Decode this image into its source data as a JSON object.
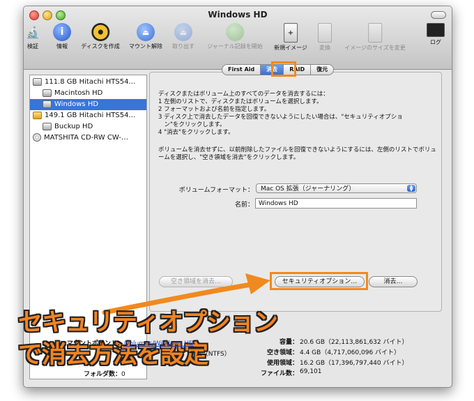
{
  "window": {
    "title": "Windows HD"
  },
  "toolbar": [
    {
      "id": "verify",
      "label": "検証",
      "icon": "microscope-icon",
      "enabled": true
    },
    {
      "id": "info",
      "label": "情報",
      "icon": "info-icon",
      "enabled": true
    },
    {
      "id": "burn",
      "label": "ディスクを作成",
      "icon": "burn-icon",
      "enabled": true
    },
    {
      "id": "unmount",
      "label": "マウント解除",
      "icon": "unmount-icon",
      "enabled": true
    },
    {
      "id": "eject",
      "label": "取り出す",
      "icon": "eject-icon",
      "enabled": false
    },
    {
      "id": "journal",
      "label": "ジャーナル記録を開始",
      "icon": "journal-icon",
      "enabled": false
    },
    {
      "id": "new-image",
      "label": "新規イメージ",
      "icon": "new-image-icon",
      "enabled": true
    },
    {
      "id": "convert",
      "label": "変換",
      "icon": "convert-icon",
      "enabled": false
    },
    {
      "id": "resize-image",
      "label": "イメージのサイズを変更",
      "icon": "resize-image-icon",
      "enabled": false
    },
    {
      "id": "log",
      "label": "ログ",
      "icon": "log-icon",
      "enabled": true
    }
  ],
  "sidebar": {
    "items": [
      {
        "label": "111.8 GB Hitachi HTS54…",
        "type": "disk",
        "indent": 0,
        "selected": false
      },
      {
        "label": "Macintosh HD",
        "type": "volume",
        "indent": 1,
        "selected": false
      },
      {
        "label": "Windows HD",
        "type": "volume",
        "indent": 1,
        "selected": true
      },
      {
        "label": "149.1 GB Hitachi HTS54…",
        "type": "external-disk",
        "indent": 0,
        "selected": false
      },
      {
        "label": "Buckup HD",
        "type": "volume",
        "indent": 1,
        "selected": false
      },
      {
        "label": "MATSHITA CD-RW CW-…",
        "type": "cd",
        "indent": 0,
        "selected": false
      }
    ]
  },
  "tabs": [
    {
      "label": "First Aid",
      "active": false
    },
    {
      "label": "消去",
      "active": true
    },
    {
      "label": "RAID",
      "active": false
    },
    {
      "label": "復元",
      "active": false
    }
  ],
  "erase": {
    "instructions": "ディスクまたはボリューム上のすべてのデータを消去するには：\n1 左側のリストで、ディスクまたはボリュームを選択します。\n2 フォーマットおよび名前を指定します。\n3 ディスク上で消去したデータを回復できないようにしたい場合は、\"セキュリティオプショ\n　ン\"をクリックします。\n4 \"消去\"をクリックします。",
    "note": "ボリュームを消去せずに、以前削除したファイルを回復できないようにするには、左側のリストでボリュームを選択し、\"空き領域を消去\"をクリックします。",
    "format_label": "ボリュームフォーマット：",
    "format_value": "Mac OS 拡張（ジャーナリング）",
    "name_label": "名前：",
    "name_value": "Windows HD",
    "erase_free_space_button": "空き領域を消去…",
    "security_options_button": "セキュリティオプション…",
    "erase_button": "消去…"
  },
  "caption": {
    "line1": "セキュリティオプション",
    "line2": "で消去方法を設定"
  },
  "info_panel": {
    "mount_point_label": "マウントポイント：",
    "mount_point_value": "/Volumes/Windows HD",
    "format_partial": "テム（NTFS）",
    "capacity_label": "容量：",
    "capacity_value": "20.6 GB（22,113,861,632 バイト）",
    "free_label": "空き領域：",
    "free_value": "4.4 GB（4,717,060,096 バイト）",
    "used_label": "使用領域：",
    "used_value": "16.2 GB（17,396,797,440 バイト）",
    "folders_label": "フォルダ数：",
    "folders_value": "0",
    "files_label": "ファイル数：",
    "files_value": "69,101"
  },
  "colors": {
    "highlight": "#f08a1e",
    "selection": "#3875d7",
    "caption": "#f5831f"
  }
}
